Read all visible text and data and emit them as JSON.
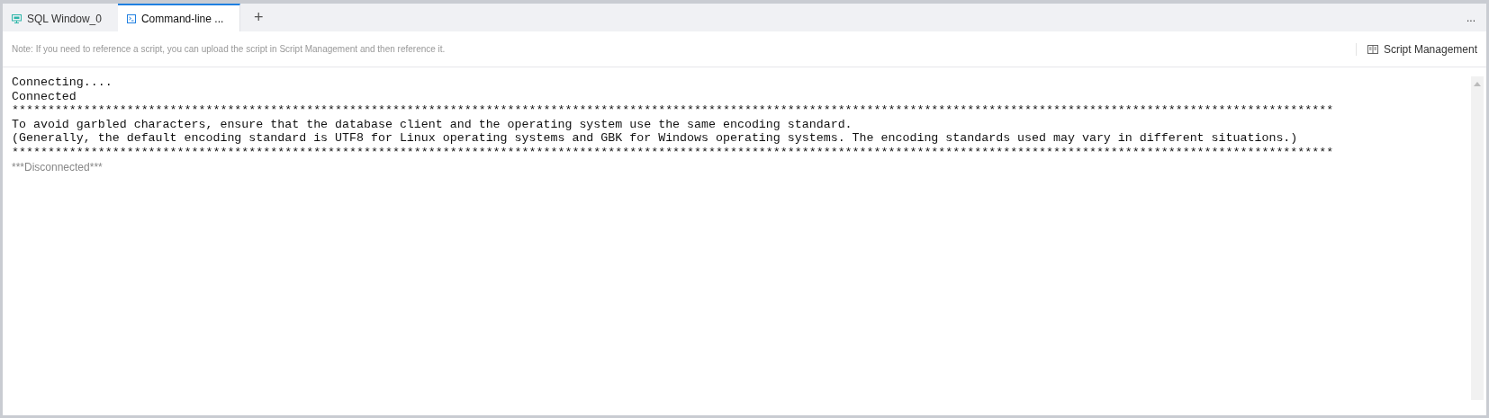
{
  "tabs": [
    {
      "label": "SQL Window_0",
      "kind": "sql",
      "selected": false
    },
    {
      "label": "Command-line ...",
      "kind": "terminal",
      "selected": true
    }
  ],
  "add_tab": "+",
  "more": "...",
  "note": "Note: If you need to reference a script, you can upload the script in Script Management and then reference it.",
  "script_management": "Script Management",
  "console": [
    {
      "kind": "output",
      "text": "Connecting...."
    },
    {
      "kind": "output",
      "text": "Connected"
    },
    {
      "kind": "output",
      "text": "****************************************************************************************************************************************************************************************"
    },
    {
      "kind": "output",
      "text": "To avoid garbled characters, ensure that the database client and the operating system use the same encoding standard."
    },
    {
      "kind": "output",
      "text": "(Generally, the default encoding standard is UTF8 for Linux operating systems and GBK for Windows operating systems. The encoding standards used may vary in different situations.)"
    },
    {
      "kind": "output",
      "text": "****************************************************************************************************************************************************************************************"
    },
    {
      "kind": "status",
      "text": "***Disconnected***"
    }
  ]
}
